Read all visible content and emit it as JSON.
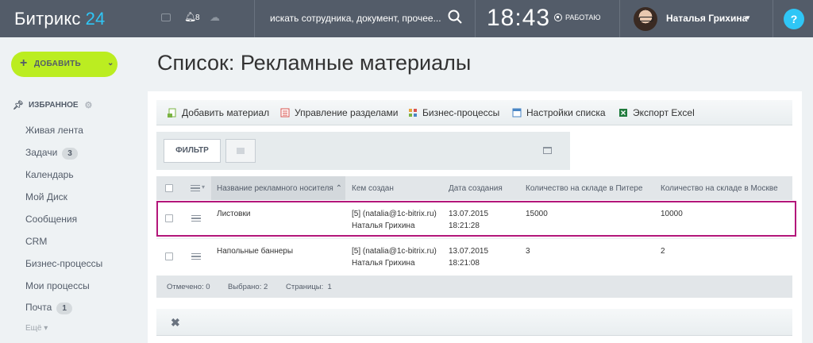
{
  "header": {
    "logo_text": "Битрикс",
    "logo_num": "24",
    "notif_count": "8",
    "search_placeholder": "искать сотрудника, документ, прочее...",
    "clock": "18:43",
    "work_status": "РАБОТАЮ",
    "user_name": "Наталья Грихина",
    "help": "?"
  },
  "sidebar": {
    "add_label": "ДОБАВИТЬ",
    "fav_title": "ИЗБРАННОЕ",
    "items": [
      {
        "label": "Живая лента",
        "badge": ""
      },
      {
        "label": "Задачи",
        "badge": "3"
      },
      {
        "label": "Календарь",
        "badge": ""
      },
      {
        "label": "Мой Диск",
        "badge": ""
      },
      {
        "label": "Сообщения",
        "badge": ""
      },
      {
        "label": "CRM",
        "badge": ""
      },
      {
        "label": "Бизнес-процессы",
        "badge": ""
      },
      {
        "label": "Мои процессы",
        "badge": ""
      },
      {
        "label": "Почта",
        "badge": "1"
      }
    ],
    "more": "Ещё"
  },
  "main": {
    "title": "Список: Рекламные материалы",
    "toolbar": [
      {
        "label": "Добавить материал",
        "icon": "add-doc-icon",
        "color": "#7ab342"
      },
      {
        "label": "Управление разделами",
        "icon": "sections-icon",
        "color": "#d9534f"
      },
      {
        "label": "Бизнес-процессы",
        "icon": "bizproc-icon",
        "color": "#e8a33d"
      },
      {
        "label": "Настройки списка",
        "icon": "settings-list-icon",
        "color": "#4a86c5"
      },
      {
        "label": "Экспорт Excel",
        "icon": "excel-icon",
        "color": "#1f7a3c"
      }
    ],
    "filter_label": "ФИЛЬТР",
    "columns": [
      "Название рекламного носителя",
      "Кем создан",
      "Дата создания",
      "Количество на складе в Питере",
      "Количество на складе в Москве"
    ],
    "rows": [
      {
        "name": "Листовки",
        "creator1": "[5] (natalia@1c-bitrix.ru)",
        "creator2": "Наталья Грихина",
        "date1": "13.07.2015",
        "date2": "18:21:28",
        "spb": "15000",
        "msk": "10000"
      },
      {
        "name": "Напольные баннеры",
        "creator1": "[5] (natalia@1c-bitrix.ru)",
        "creator2": "Наталья Грихина",
        "date1": "13.07.2015",
        "date2": "18:21:08",
        "spb": "3",
        "msk": "2"
      }
    ],
    "footer": {
      "marked": "Отмечено: 0",
      "selected": "Выбрано: 2",
      "pages": "Страницы:  1"
    }
  },
  "colors": {
    "header_bg": "#535c69",
    "accent": "#2fc6f6",
    "add_button": "#bbed21",
    "highlight": "#b3167a"
  }
}
